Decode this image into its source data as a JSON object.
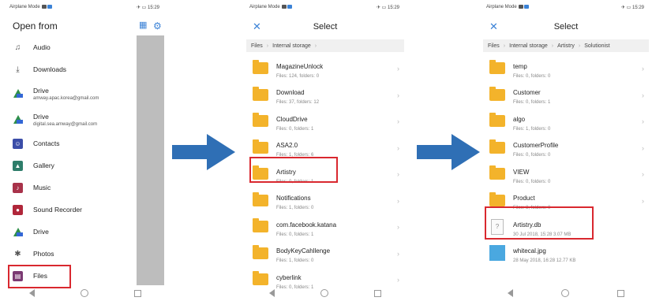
{
  "status": {
    "left": "Airplane Mode",
    "right": "15:29"
  },
  "colors": {
    "accent": "#3b82d6",
    "highlight": "#d9282f",
    "folder": "#f3b32b",
    "arrow": "#2f6fb5"
  },
  "phone1": {
    "title": "Open from",
    "items": [
      {
        "label": "Audio",
        "sub": "",
        "icon": "audio-icon"
      },
      {
        "label": "Downloads",
        "sub": "",
        "icon": "download-icon"
      },
      {
        "label": "Drive",
        "sub": "amway.apac.korea@gmail.com",
        "icon": "drive-icon"
      },
      {
        "label": "Drive",
        "sub": "digital.sea.amway@gmail.com",
        "icon": "drive-icon"
      },
      {
        "label": "Contacts",
        "sub": "",
        "icon": "contacts-icon"
      },
      {
        "label": "Gallery",
        "sub": "",
        "icon": "gallery-icon"
      },
      {
        "label": "Music",
        "sub": "",
        "icon": "music-icon"
      },
      {
        "label": "Sound Recorder",
        "sub": "",
        "icon": "recorder-icon"
      },
      {
        "label": "Drive",
        "sub": "",
        "icon": "drive-icon"
      },
      {
        "label": "Photos",
        "sub": "",
        "icon": "photos-icon"
      },
      {
        "label": "Files",
        "sub": "",
        "icon": "files-icon"
      }
    ]
  },
  "phone2": {
    "title": "Select",
    "crumbs": [
      "Files",
      "Internal storage"
    ],
    "items": [
      {
        "name": "MagazineUnlock",
        "meta": "Files: 124, folders: 0"
      },
      {
        "name": "Download",
        "meta": "Files: 37, folders: 12"
      },
      {
        "name": "CloudDrive",
        "meta": "Files: 0, folders: 1"
      },
      {
        "name": "ASA2.0",
        "meta": "Files: 1, folders: 6"
      },
      {
        "name": "Artistry",
        "meta": "Files: 0, folders: 1"
      },
      {
        "name": "Notifications",
        "meta": "Files: 1, folders: 0"
      },
      {
        "name": "com.facebook.katana",
        "meta": "Files: 0, folders: 1"
      },
      {
        "name": "BodyKeyCahllenge",
        "meta": "Files: 1, folders: 0"
      },
      {
        "name": "cyberlink",
        "meta": "Files: 0, folders: 1"
      }
    ]
  },
  "phone3": {
    "title": "Select",
    "crumbs": [
      "Files",
      "Internal storage",
      "Artistry",
      "Solutionist"
    ],
    "folders": [
      {
        "name": "temp",
        "meta": "Files: 0, folders: 0"
      },
      {
        "name": "Customer",
        "meta": "Files: 0, folders: 1"
      },
      {
        "name": "algo",
        "meta": "Files: 1, folders: 0"
      },
      {
        "name": "CustomerProfile",
        "meta": "Files: 0, folders: 0"
      },
      {
        "name": "VIEW",
        "meta": "Files: 0, folders: 0"
      },
      {
        "name": "Product",
        "meta": "Files: 8, folders: 0"
      }
    ],
    "files": [
      {
        "name": "Artistry.db",
        "meta": "30 Jul 2018, 15:28 3.07 MB",
        "icon": "unknown-file-icon"
      },
      {
        "name": "whitecal.jpg",
        "meta": "28 May 2018, 16:28 12.77 KB",
        "icon": "image-file-icon"
      }
    ]
  }
}
